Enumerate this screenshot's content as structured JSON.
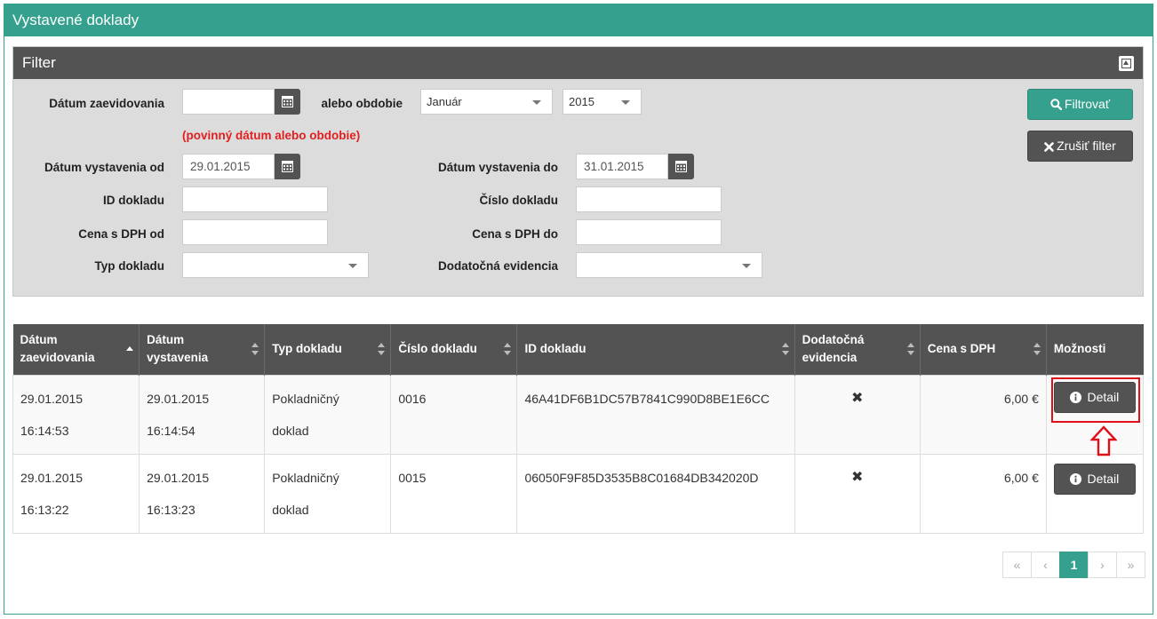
{
  "page_title": "Vystavené doklady",
  "filter": {
    "title": "Filter",
    "date_registered_label": "Dátum zaevidovania",
    "date_registered_value": "",
    "period_label": "alebo obdobie",
    "period_month": "Január",
    "period_year": "2015",
    "required_note": "(povinný dátum alebo obdobie)",
    "issued_from_label": "Dátum vystavenia od",
    "issued_from_value": "29.01.2015",
    "issued_to_label": "Dátum vystavenia do",
    "issued_to_value": "31.01.2015",
    "doc_id_label": "ID dokladu",
    "doc_number_label": "Číslo dokladu",
    "price_from_label": "Cena s DPH od",
    "price_to_label": "Cena s DPH do",
    "doc_type_label": "Typ dokladu",
    "extra_record_label": "Dodatočná evidencia",
    "filter_button": "Filtrovať",
    "clear_button": "Zrušiť filter"
  },
  "table": {
    "headers": {
      "registered_l1": "Dátum",
      "registered_l2": "zaevidovania",
      "issued_l1": "Dátum",
      "issued_l2": "vystavenia",
      "type": "Typ dokladu",
      "number": "Číslo dokladu",
      "id": "ID dokladu",
      "extra_l1": "Dodatočná",
      "extra_l2": "evidencia",
      "price": "Cena s DPH",
      "options": "Možnosti"
    },
    "rows": [
      {
        "registered_date": "29.01.2015",
        "registered_time": "16:14:53",
        "issued_date": "29.01.2015",
        "issued_time": "16:14:54",
        "type_l1": "Pokladničný",
        "type_l2": "doklad",
        "number": "0016",
        "id": "46A41DF6B1DC57B7841C990D8BE1E6CC",
        "extra": "✖",
        "price": "6,00 €",
        "action": "Detail"
      },
      {
        "registered_date": "29.01.2015",
        "registered_time": "16:13:22",
        "issued_date": "29.01.2015",
        "issued_time": "16:13:23",
        "type_l1": "Pokladničný",
        "type_l2": "doklad",
        "number": "0015",
        "id": "06050F9F85D3535B8C01684DB342020D",
        "extra": "✖",
        "price": "6,00 €",
        "action": "Detail"
      }
    ]
  },
  "pagination": {
    "first": "«",
    "prev": "‹",
    "current": "1",
    "next": "›",
    "last": "»"
  },
  "colors": {
    "accent": "#35a08d",
    "dark": "#535353",
    "warning": "#e02020",
    "highlight": "#e0101a"
  }
}
